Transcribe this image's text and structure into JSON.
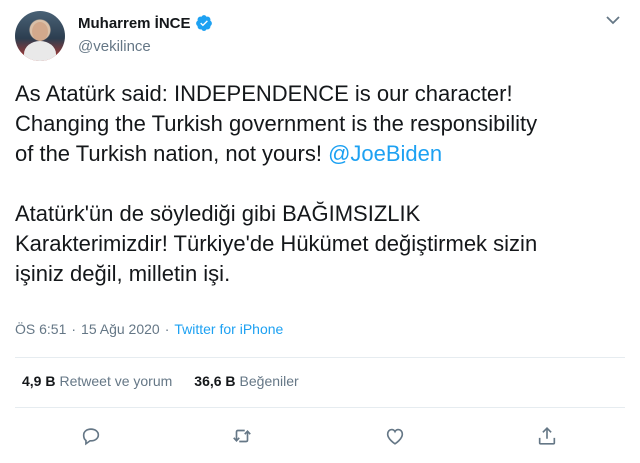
{
  "author": {
    "display_name": "Muharrem İNCE",
    "handle": "@vekilince",
    "verified": true
  },
  "tweet": {
    "text_part1": "As Atatürk said: INDEPENDENCE is our character!\nChanging the Turkish government is the responsibility\nof the Turkish nation, not yours! ",
    "mention": "@JoeBiden",
    "text_part2": "\n\nAtatürk'ün de söylediği gibi BAĞIMSIZLIK\nKarakterimizdir! Türkiye'de Hükümet değiştirmek sizin\nişiniz değil, milletin işi."
  },
  "meta": {
    "time": "ÖS 6:51",
    "separator": "·",
    "date": "15 Ağu 2020",
    "source": "Twitter for iPhone"
  },
  "stats": {
    "retweets_count": "4,9 B",
    "retweets_label": "Retweet ve yorum",
    "likes_count": "36,6 B",
    "likes_label": "Beğeniler"
  },
  "icons": {
    "reply": "reply-icon",
    "retweet": "retweet-icon",
    "like": "heart-icon",
    "share": "share-icon",
    "more": "chevron-down-icon",
    "verified": "verified-badge-icon"
  },
  "colors": {
    "accent": "#1da1f2",
    "secondary_text": "#657786",
    "primary_text": "#14171a"
  }
}
